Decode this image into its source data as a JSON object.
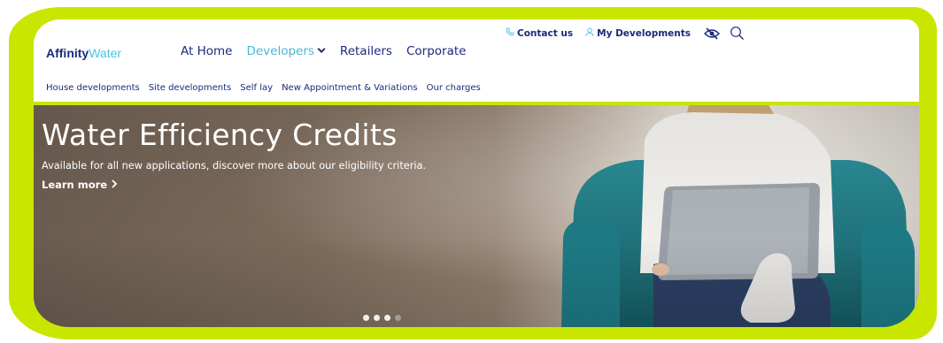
{
  "logo": {
    "part1": "Affinity",
    "part2": "Water"
  },
  "utility": {
    "contact_label": "Contact us",
    "contact_icon": "phone-icon",
    "developments_label": "My Developments",
    "developments_icon": "user-icon",
    "accessibility_icon": "eye-slash-icon",
    "search_icon": "search-icon"
  },
  "main_nav": {
    "items": [
      {
        "label": "At Home"
      },
      {
        "label": "Developers",
        "active": true,
        "has_dropdown": true
      },
      {
        "label": "Retailers"
      },
      {
        "label": "Corporate"
      }
    ]
  },
  "sub_nav": {
    "items": [
      {
        "label": "House developments"
      },
      {
        "label": "Site developments"
      },
      {
        "label": "Self lay"
      },
      {
        "label": "New Appointment & Variations"
      },
      {
        "label": "Our charges"
      }
    ]
  },
  "hero": {
    "title": "Water Efficiency Credits",
    "subtitle": "Available for all new applications, discover more about our eligibility criteria.",
    "link_label": "Learn more",
    "link_icon": "chevron-right-icon",
    "slides_total": 4,
    "active_slide": 1
  },
  "colors": {
    "navy": "#1b2a7a",
    "light_blue": "#47c3e4",
    "lime": "#c8e600",
    "teal_chair": "#1f6f78"
  }
}
